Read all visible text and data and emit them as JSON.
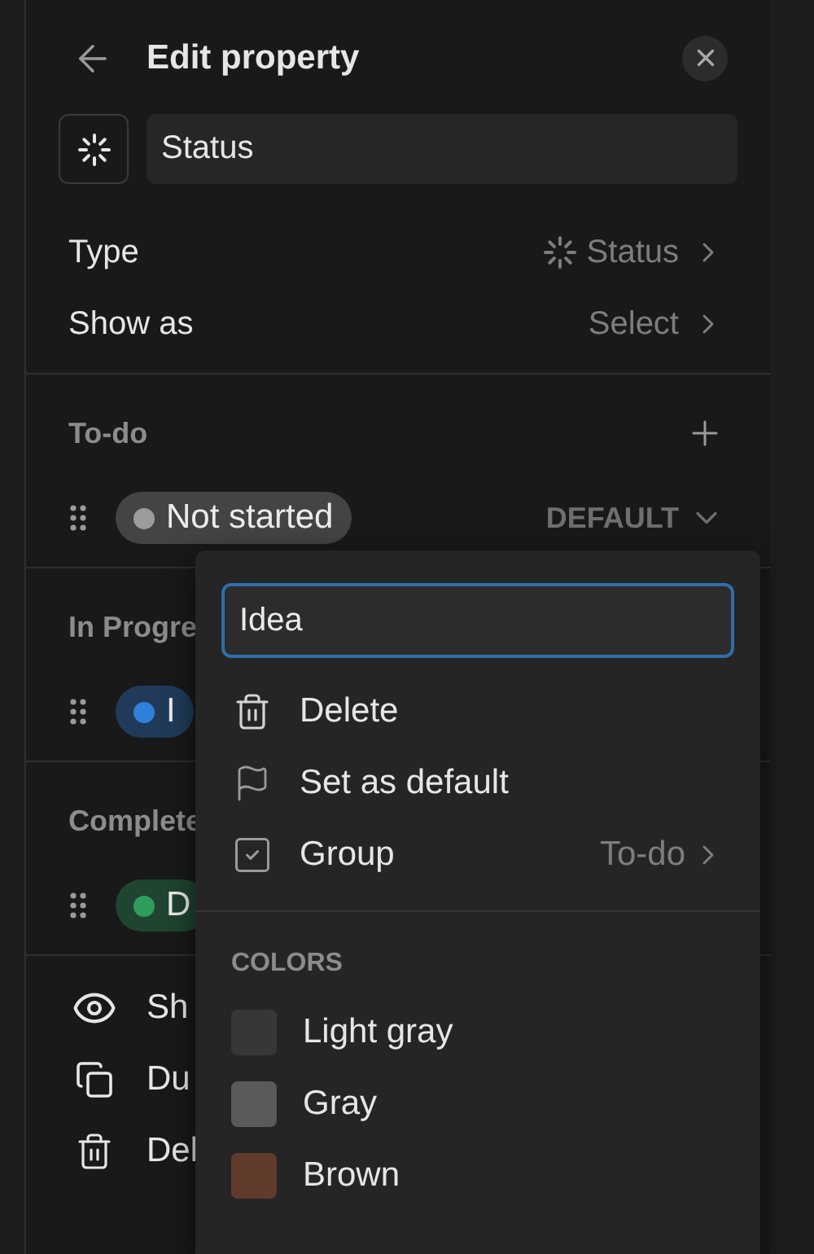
{
  "header": {
    "title": "Edit property"
  },
  "name_field": {
    "value": "Status"
  },
  "settings": [
    {
      "kind": "icon-value",
      "label": "Type",
      "value": "Status"
    },
    {
      "kind": "value",
      "label": "Show as",
      "value": "Select"
    }
  ],
  "groups": [
    {
      "title": "To-do",
      "addable": true,
      "options": [
        {
          "label": "Not started",
          "color": "#9b9b9b",
          "badge": "DEFAULT"
        }
      ]
    },
    {
      "title": "In Progre",
      "addable": false,
      "options": [
        {
          "label": "I",
          "color": "#2f80da"
        }
      ]
    },
    {
      "title": "Complete",
      "addable": false,
      "options": [
        {
          "label": "D",
          "color": "#2e9d5e"
        }
      ]
    }
  ],
  "actions": [
    {
      "kind": "eye",
      "label": "Sh"
    },
    {
      "kind": "duplicate",
      "label": "Du"
    },
    {
      "kind": "trash",
      "label": "Del"
    }
  ],
  "popover": {
    "input_value": "Idea",
    "items": [
      {
        "kind": "trash",
        "label": "Delete"
      },
      {
        "kind": "flag",
        "label": "Set as default"
      },
      {
        "kind": "checkbox",
        "label": "Group",
        "checked": true,
        "value": "To-do"
      }
    ],
    "colors_heading": "COLORS",
    "colors": [
      {
        "label": "Light gray",
        "color": "#373737"
      },
      {
        "label": "Gray",
        "color": "#5a5a5a"
      },
      {
        "label": "Brown",
        "color": "#603b2c"
      }
    ]
  }
}
